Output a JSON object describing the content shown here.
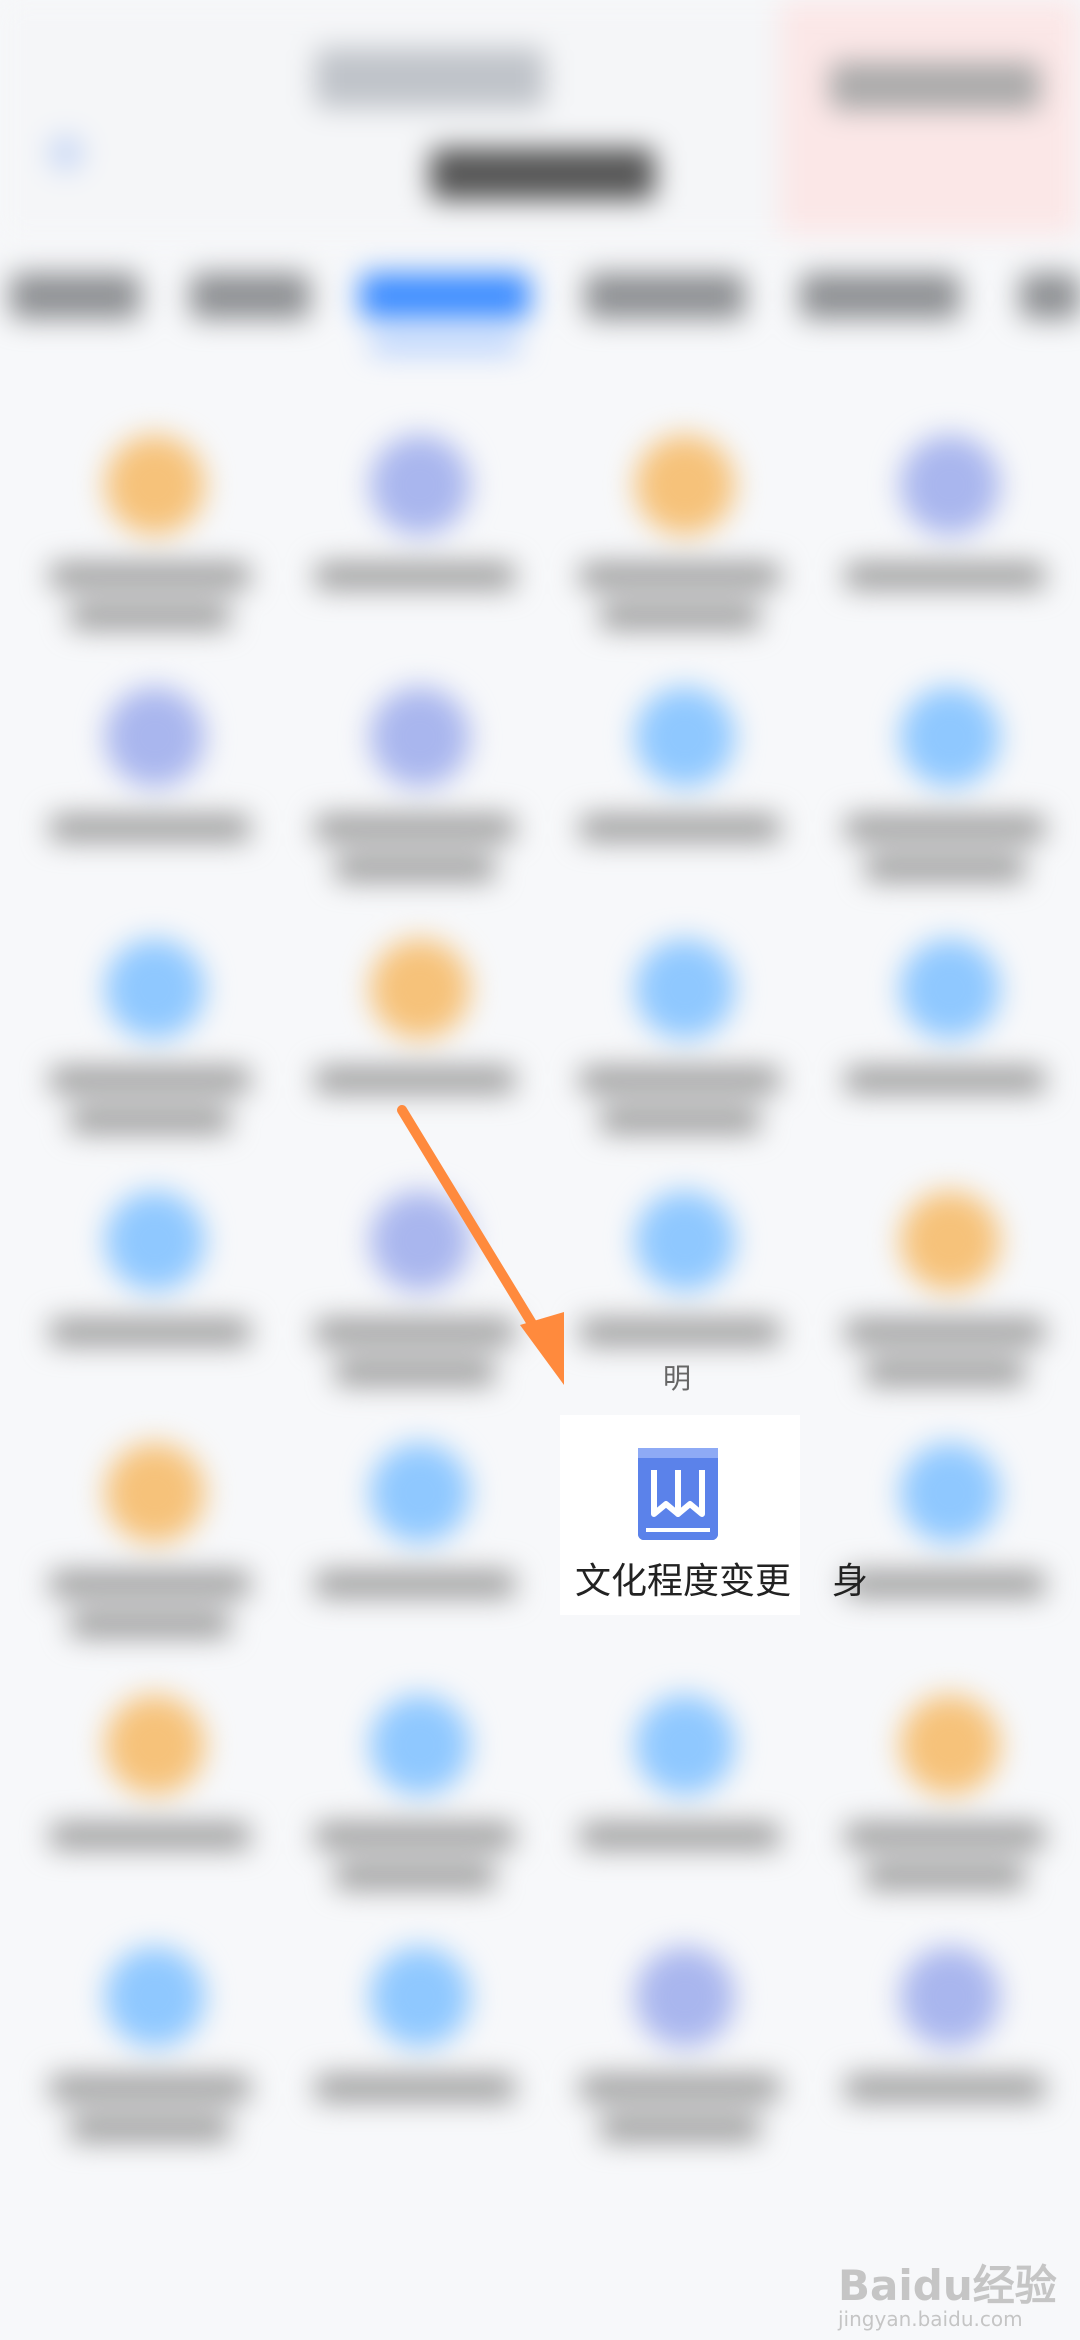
{
  "focused_item": {
    "label": "文化程度变更",
    "icon": "bookmark-document-icon",
    "icon_color": "#5b82ea"
  },
  "peek_label": "身",
  "peek_fragment": "明",
  "arrow_color": "#ff8a3d",
  "watermark": {
    "brand": "Baidu经验",
    "site": "jingyan.baidu.com"
  },
  "colors": {
    "orange_icon": "#f6c27a",
    "blue_icon": "#8fc8ff",
    "indigo_icon": "#a9b6ee",
    "tab_active": "#3c8cff"
  }
}
